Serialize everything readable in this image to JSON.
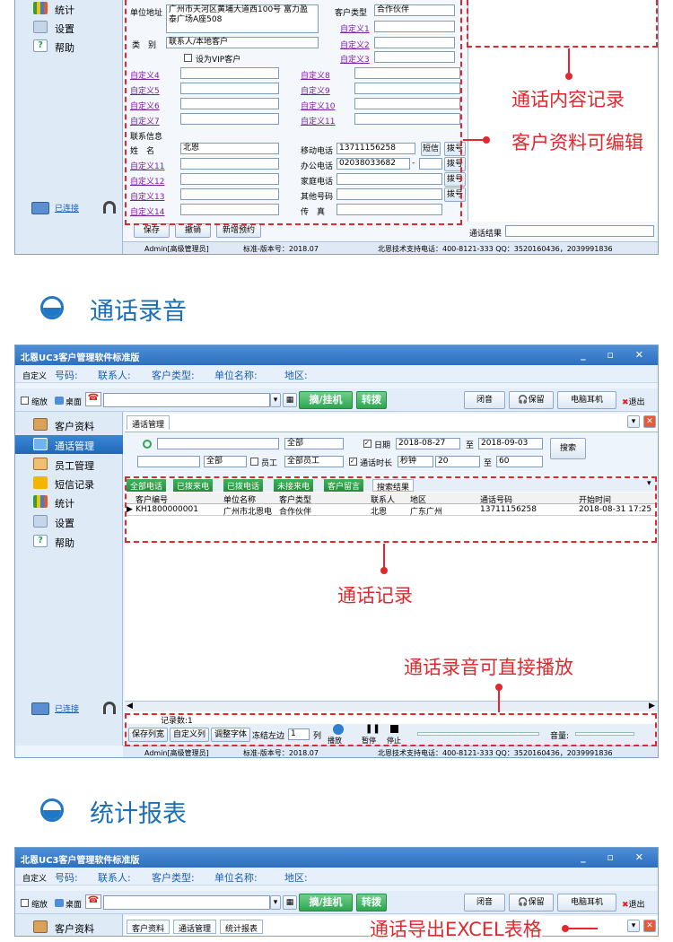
{
  "colors": {
    "accent": "#e0282e",
    "title_blue": "#1a6fb5",
    "titlebar": "#2f6fc0",
    "green": "#2fa551"
  },
  "win_common": {
    "app_title": "北恩UC3客户管理软件标准版",
    "custom_label": "自定义",
    "query_labels": [
      "号码:",
      "联系人:",
      "客户类型:",
      "单位名称:",
      "地区:"
    ],
    "shrink": "缩放",
    "desktop": "桌面",
    "pickup_hangup": "摘/挂机",
    "transfer": "转拨",
    "mute": "闭音",
    "hold": "保留",
    "pc_headset": "电脑耳机",
    "exit": "退出",
    "connected": "已连接",
    "status_user": "Admin[高级管理员]",
    "status_version": "标准-版本号：2018.07",
    "status_support": "北恩技术支持电话：400-8121-333  QQ：3520160436，2039991836"
  },
  "sidebar_items": [
    "客户资料",
    "通话管理",
    "员工管理",
    "短信记录",
    "统计",
    "设置",
    "帮助"
  ],
  "win1": {
    "sidebar": [
      "统计",
      "设置",
      "帮助"
    ],
    "address_label": "单位地址",
    "address_value": "广州市天河区黄埔大道西100号 富力盈泰广场A座508",
    "customer_type_label": "客户类型",
    "customer_type_value": "合作伙伴",
    "category_label": "类　别",
    "category_value": "联系人/本地客户",
    "vip_label": "设为VIP客户",
    "custom_right_top": [
      "自定义1",
      "自定义2",
      "自定义3"
    ],
    "custom_left": [
      "自定义4",
      "自定义5",
      "自定义6",
      "自定义7"
    ],
    "custom_mid": [
      "自定义8",
      "自定义9",
      "自定义10",
      "自定义11"
    ],
    "contact_info": "联系信息",
    "name_label": "姓　名",
    "name_value": "北恩",
    "mobile_label": "移动电话",
    "mobile_value": "13711156258",
    "office_label": "办公电话",
    "office_value": "02038033682",
    "home_label": "家庭电话",
    "other_label": "其他号码",
    "fax_label": "传　真",
    "sms_btn": "短信",
    "dial_btn": "拨号",
    "custom_bottom": [
      "自定义11",
      "自定义12",
      "自定义13",
      "自定义14"
    ],
    "save": "保存",
    "cancel": "撤销",
    "new_appointment": "新增预约",
    "call_result": "通话结果",
    "anno_call_content": "通话内容记录",
    "anno_editable": "客户资料可编辑"
  },
  "section2_title": "通话录音",
  "win2": {
    "tab_call_mgmt": "通话管理",
    "filter": {
      "all": "全部",
      "date_label": "日期",
      "date_from": "2018-08-27",
      "to": "至",
      "date_to": "2018-09-03",
      "search": "搜索",
      "all2": "全部",
      "employee_label": "员工",
      "all_employees": "全部员工",
      "duration_label": "通话时长",
      "unit": "秒钟",
      "dur_from": "20",
      "dur_to": "60"
    },
    "subtabs": [
      "全部电话",
      "已拨来电",
      "已拨电话",
      "未接来电",
      "客户留言",
      "搜索结果"
    ],
    "columns": [
      "客户编号",
      "单位名称",
      "客户类型",
      "联系人",
      "地区",
      "通话号码",
      "开始时间"
    ],
    "rows": [
      [
        "KH1800000001",
        "广州市北恩电",
        "合作伙伴",
        "北恩",
        "广东广州",
        "13711156258",
        "2018-08-31 17:25"
      ]
    ],
    "record_count": "记录数:1",
    "bottom_btns": [
      "保存列宽",
      "自定义列",
      "调整字体",
      "冻结左边"
    ],
    "freeze_value": "1",
    "freeze_unit": "列",
    "play": "播放",
    "pause": "暂停",
    "stop": "停止",
    "volume": "音量:",
    "anno_records": "通话记录",
    "anno_play": "通话录音可直接播放"
  },
  "section3_title": "统计报表",
  "win3": {
    "tabs": [
      "客户资料",
      "通话管理",
      "统计报表"
    ],
    "anno_excel": "通话导出EXCEL表格"
  }
}
